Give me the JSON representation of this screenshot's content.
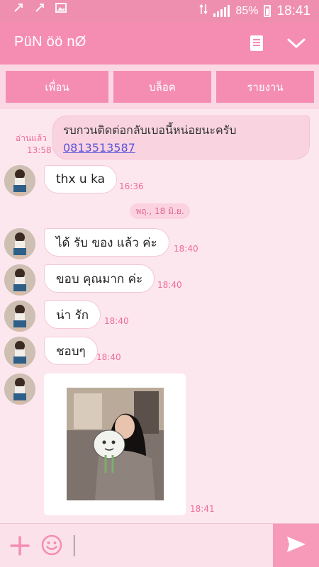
{
  "status": {
    "battery": "85%",
    "time": "18:41"
  },
  "header": {
    "title": "PüN öö nØ"
  },
  "actions": {
    "friend": "เพื่อน",
    "block": "บล็อค",
    "report": "รายงาน"
  },
  "messages": {
    "outgoing": {
      "text": "รบกวนติดต่อกลับเบอนี้หน่อยนะครับ",
      "link": "0813513587",
      "read_label": "อ่านแล้ว",
      "time": "13:58"
    },
    "m1": {
      "text": "thx u ka",
      "time": "16:36"
    },
    "date_divider": "พฤ., 18 มิ.ย.",
    "m2": {
      "text": "ได้ รับ ของ แล้ว ค่ะ",
      "time": "18:40"
    },
    "m3": {
      "text": "ขอบ คุณมาก ค่ะ",
      "time": "18:40"
    },
    "m4": {
      "text": "น่า รัก",
      "time": "18:40"
    },
    "m5": {
      "text": "ชอบๆ",
      "time": "18:40"
    },
    "photo": {
      "time": "18:41"
    }
  },
  "colors": {
    "accent": "#f58db3",
    "background": "#fde7ef",
    "time": "#ef6b98",
    "link": "#5a55d8"
  }
}
